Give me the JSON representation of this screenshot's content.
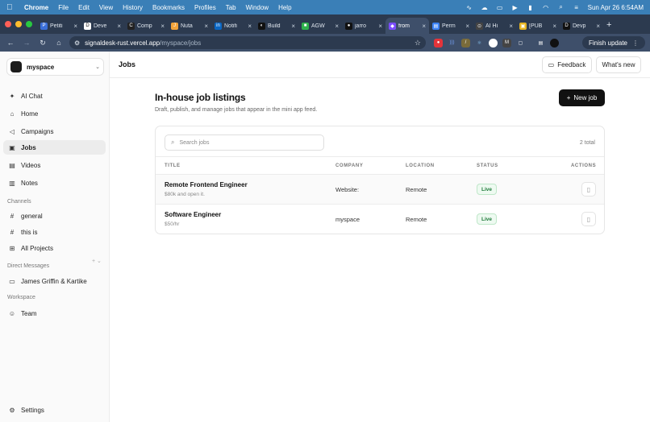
{
  "menubar": {
    "app_name": "Chrome",
    "items": [
      "File",
      "Edit",
      "View",
      "History",
      "Bookmarks",
      "Profiles",
      "Tab",
      "Window",
      "Help"
    ],
    "clock": "Sun Apr 26  6:54AM"
  },
  "tabs": [
    {
      "title": "Petiti",
      "color": "#3b6fd8",
      "glyph": "P"
    },
    {
      "title": "Deve",
      "color": "#ffffff",
      "glyph": "D"
    },
    {
      "title": "Comp",
      "color": "#222222",
      "glyph": "C"
    },
    {
      "title": "Nuta",
      "color": "#f2a33a",
      "glyph": "J"
    },
    {
      "title": "Notifi",
      "color": "#0a66c2",
      "glyph": "in"
    },
    {
      "title": "Build",
      "color": "#111111",
      "glyph": "◐"
    },
    {
      "title": "AGW",
      "color": "#2fb24c",
      "glyph": "■"
    },
    {
      "title": "jarro",
      "color": "#111111",
      "glyph": "●"
    },
    {
      "title": "from",
      "color": "#7b4cff",
      "glyph": "◆",
      "active": true
    },
    {
      "title": "Perm",
      "color": "#3b82f6",
      "glyph": "▤"
    },
    {
      "title": "AI Hi",
      "color": "#444444",
      "glyph": "⊙"
    },
    {
      "title": "[PUB",
      "color": "#e6b422",
      "glyph": "▣"
    },
    {
      "title": "Devp",
      "color": "#111111",
      "glyph": "D"
    }
  ],
  "address": {
    "host": "signaldesk-rust.vercel.app",
    "path": "/myspace/jobs",
    "finish_update": "Finish update"
  },
  "sidebar": {
    "workspace": "myspace",
    "nav": [
      {
        "label": "AI Chat",
        "icon": "sparkle-icon"
      },
      {
        "label": "Home",
        "icon": "home-icon"
      },
      {
        "label": "Campaigns",
        "icon": "megaphone-icon"
      },
      {
        "label": "Jobs",
        "icon": "briefcase-icon",
        "active": true
      },
      {
        "label": "Videos",
        "icon": "video-icon"
      },
      {
        "label": "Notes",
        "icon": "note-icon"
      }
    ],
    "channels_label": "Channels",
    "channels": [
      {
        "label": "general",
        "icon": "hash-icon"
      },
      {
        "label": "this is",
        "icon": "hash-icon"
      },
      {
        "label": "All Projects",
        "icon": "grid-icon"
      }
    ],
    "dm_label": "Direct Messages",
    "dms": [
      {
        "label": "James Griffin & Kartike",
        "icon": "chat-icon"
      }
    ],
    "workspace_label": "Workspace",
    "workspace_items": [
      {
        "label": "Team",
        "icon": "users-icon"
      }
    ],
    "settings": "Settings"
  },
  "header": {
    "title": "Jobs",
    "feedback": "Feedback",
    "whats_new": "What's new"
  },
  "page": {
    "title": "In-house job listings",
    "subtitle": "Draft, publish, and manage jobs that appear in the mini app feed.",
    "new_job": "New job",
    "search_placeholder": "Search jobs",
    "total": "2 total",
    "columns": [
      "TITLE",
      "COMPANY",
      "LOCATION",
      "STATUS",
      "ACTIONS"
    ],
    "rows": [
      {
        "title": "Remote Frontend Engineer",
        "sub": "$80k and open it.",
        "company": "Website:",
        "location": "Remote",
        "status": "Live"
      },
      {
        "title": "Software Engineer",
        "sub": "$50/hr",
        "company": "myspace",
        "location": "Remote",
        "status": "Live"
      }
    ]
  }
}
